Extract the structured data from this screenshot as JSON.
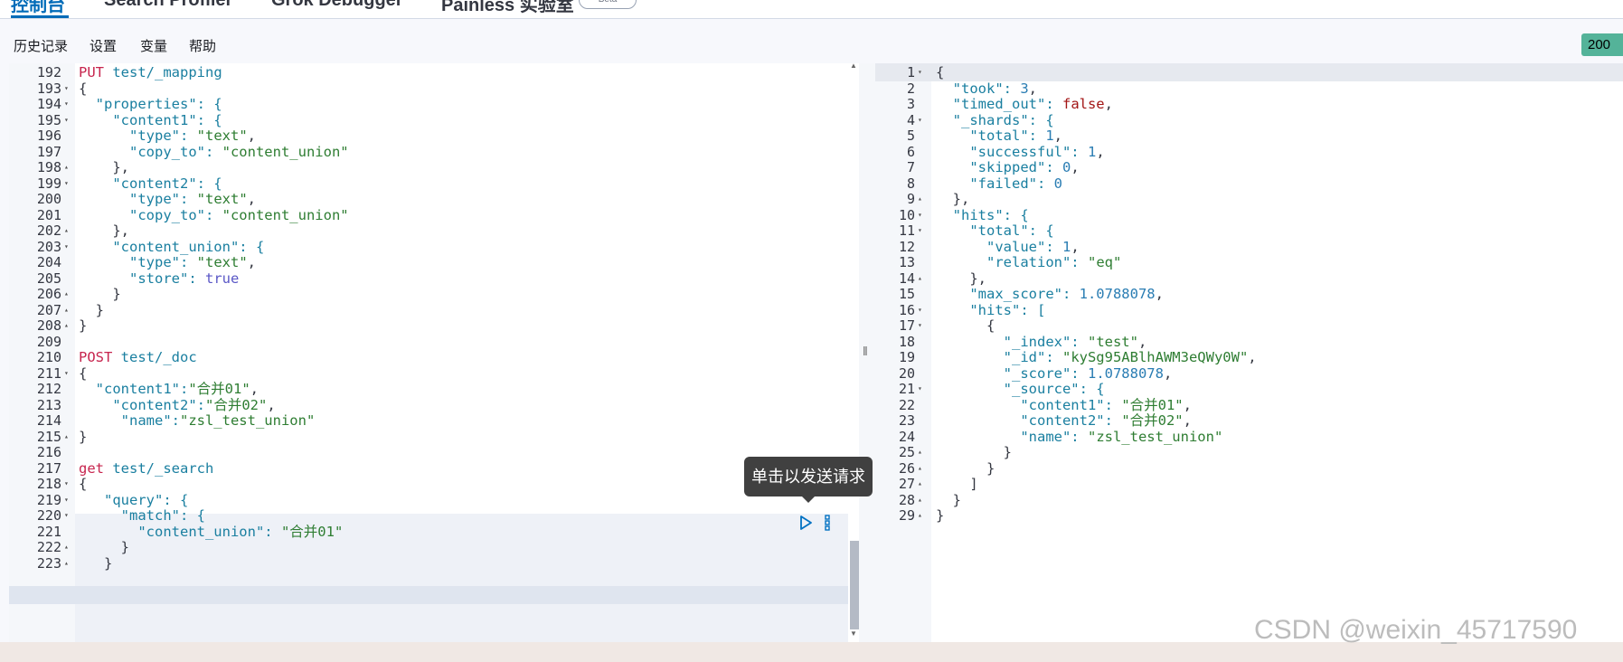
{
  "tabs": [
    "控制台",
    "Search Profiler",
    "Grok Debugger",
    "Painless 实验室"
  ],
  "beta_badge": "Beta",
  "menu": [
    "历史记录",
    "设置",
    "变量",
    "帮助"
  ],
  "status_code": "200",
  "tooltip": "单击以发送请求",
  "watermark": "CSDN @weixin_45717590",
  "request_lines": [
    {
      "n": "192",
      "f": "",
      "t": [
        [
          "PUT",
          "m"
        ],
        [
          " test/_mapping",
          "k"
        ]
      ]
    },
    {
      "n": "193",
      "f": "▾",
      "t": [
        [
          "{",
          ""
        ]
      ]
    },
    {
      "n": "194",
      "f": "▾",
      "t": [
        [
          "  \"properties\": {",
          "k"
        ]
      ]
    },
    {
      "n": "195",
      "f": "▾",
      "t": [
        [
          "    \"content1\": {",
          "k"
        ]
      ]
    },
    {
      "n": "196",
      "f": "",
      "t": [
        [
          "      \"type\": ",
          "k"
        ],
        [
          "\"text\"",
          "s"
        ],
        [
          ",",
          ""
        ]
      ]
    },
    {
      "n": "197",
      "f": "",
      "t": [
        [
          "      \"copy_to\": ",
          "k"
        ],
        [
          "\"content_union\"",
          "s"
        ]
      ]
    },
    {
      "n": "198",
      "f": "▴",
      "t": [
        [
          "    },",
          ""
        ]
      ]
    },
    {
      "n": "199",
      "f": "▾",
      "t": [
        [
          "    \"content2\": {",
          "k"
        ]
      ]
    },
    {
      "n": "200",
      "f": "",
      "t": [
        [
          "      \"type\": ",
          "k"
        ],
        [
          "\"text\"",
          "s"
        ],
        [
          ",",
          ""
        ]
      ]
    },
    {
      "n": "201",
      "f": "",
      "t": [
        [
          "      \"copy_to\": ",
          "k"
        ],
        [
          "\"content_union\"",
          "s"
        ]
      ]
    },
    {
      "n": "202",
      "f": "▴",
      "t": [
        [
          "    },",
          ""
        ]
      ]
    },
    {
      "n": "203",
      "f": "▾",
      "t": [
        [
          "    \"content_union\": {",
          "k"
        ]
      ]
    },
    {
      "n": "204",
      "f": "",
      "t": [
        [
          "      \"type\": ",
          "k"
        ],
        [
          "\"text\"",
          "s"
        ],
        [
          ",",
          ""
        ]
      ]
    },
    {
      "n": "205",
      "f": "",
      "t": [
        [
          "      \"store\": ",
          "k"
        ],
        [
          "true",
          "t"
        ]
      ]
    },
    {
      "n": "206",
      "f": "▴",
      "t": [
        [
          "    }",
          ""
        ]
      ]
    },
    {
      "n": "207",
      "f": "▴",
      "t": [
        [
          "  }",
          ""
        ]
      ]
    },
    {
      "n": "208",
      "f": "▴",
      "t": [
        [
          "}",
          ""
        ]
      ]
    },
    {
      "n": "209",
      "f": "",
      "t": [
        [
          "",
          ""
        ]
      ]
    },
    {
      "n": "210",
      "f": "",
      "t": [
        [
          "POST",
          "m"
        ],
        [
          " test/_doc",
          "k"
        ]
      ]
    },
    {
      "n": "211",
      "f": "▾",
      "t": [
        [
          "{",
          ""
        ]
      ]
    },
    {
      "n": "212",
      "f": "",
      "t": [
        [
          "  \"content1\":",
          "k"
        ],
        [
          "\"合并01\"",
          "s"
        ],
        [
          ",",
          ""
        ]
      ]
    },
    {
      "n": "213",
      "f": "",
      "t": [
        [
          "    \"content2\":",
          "k"
        ],
        [
          "\"合并02\"",
          "s"
        ],
        [
          ",",
          ""
        ]
      ]
    },
    {
      "n": "214",
      "f": "",
      "t": [
        [
          "     \"name\":",
          "k"
        ],
        [
          "\"zsl_test_union\"",
          "s"
        ]
      ]
    },
    {
      "n": "215",
      "f": "▴",
      "t": [
        [
          "}",
          ""
        ]
      ]
    },
    {
      "n": "216",
      "f": "",
      "t": [
        [
          "",
          ""
        ]
      ]
    },
    {
      "n": "217",
      "f": "",
      "t": [
        [
          "get",
          "m"
        ],
        [
          " test/_search",
          "k"
        ]
      ]
    },
    {
      "n": "218",
      "f": "▾",
      "t": [
        [
          "{",
          ""
        ]
      ]
    },
    {
      "n": "219",
      "f": "▾",
      "t": [
        [
          "   \"query\": {",
          "k"
        ]
      ]
    },
    {
      "n": "220",
      "f": "▾",
      "t": [
        [
          "     \"match\": {",
          "k"
        ]
      ]
    },
    {
      "n": "221",
      "f": "",
      "t": [
        [
          "       \"content_union\": ",
          "k"
        ],
        [
          "\"合并01\"",
          "s"
        ]
      ]
    },
    {
      "n": "222",
      "f": "▴",
      "t": [
        [
          "     }",
          ""
        ]
      ]
    },
    {
      "n": "223",
      "f": "▴",
      "t": [
        [
          "   }",
          ""
        ]
      ]
    }
  ],
  "response_lines": [
    {
      "n": "1",
      "f": "▾",
      "t": [
        [
          "{",
          ""
        ]
      ]
    },
    {
      "n": "2",
      "f": "",
      "t": [
        [
          "  \"took\": ",
          "k"
        ],
        [
          "3",
          "n"
        ],
        [
          ",",
          ""
        ]
      ]
    },
    {
      "n": "3",
      "f": "",
      "t": [
        [
          "  \"timed_out\": ",
          "k"
        ],
        [
          "false",
          "b"
        ],
        [
          ",",
          ""
        ]
      ]
    },
    {
      "n": "4",
      "f": "▾",
      "t": [
        [
          "  \"_shards\": {",
          "k"
        ]
      ]
    },
    {
      "n": "5",
      "f": "",
      "t": [
        [
          "    \"total\": ",
          "k"
        ],
        [
          "1",
          "n"
        ],
        [
          ",",
          ""
        ]
      ]
    },
    {
      "n": "6",
      "f": "",
      "t": [
        [
          "    \"successful\": ",
          "k"
        ],
        [
          "1",
          "n"
        ],
        [
          ",",
          ""
        ]
      ]
    },
    {
      "n": "7",
      "f": "",
      "t": [
        [
          "    \"skipped\": ",
          "k"
        ],
        [
          "0",
          "n"
        ],
        [
          ",",
          ""
        ]
      ]
    },
    {
      "n": "8",
      "f": "",
      "t": [
        [
          "    \"failed\": ",
          "k"
        ],
        [
          "0",
          "n"
        ]
      ]
    },
    {
      "n": "9",
      "f": "▴",
      "t": [
        [
          "  },",
          ""
        ]
      ]
    },
    {
      "n": "10",
      "f": "▾",
      "t": [
        [
          "  \"hits\": {",
          "k"
        ]
      ]
    },
    {
      "n": "11",
      "f": "▾",
      "t": [
        [
          "    \"total\": {",
          "k"
        ]
      ]
    },
    {
      "n": "12",
      "f": "",
      "t": [
        [
          "      \"value\": ",
          "k"
        ],
        [
          "1",
          "n"
        ],
        [
          ",",
          ""
        ]
      ]
    },
    {
      "n": "13",
      "f": "",
      "t": [
        [
          "      \"relation\": ",
          "k"
        ],
        [
          "\"eq\"",
          "s"
        ]
      ]
    },
    {
      "n": "14",
      "f": "▴",
      "t": [
        [
          "    },",
          ""
        ]
      ]
    },
    {
      "n": "15",
      "f": "",
      "t": [
        [
          "    \"max_score\": ",
          "k"
        ],
        [
          "1.0788078",
          "n"
        ],
        [
          ",",
          ""
        ]
      ]
    },
    {
      "n": "16",
      "f": "▾",
      "t": [
        [
          "    \"hits\": [",
          "k"
        ]
      ]
    },
    {
      "n": "17",
      "f": "▾",
      "t": [
        [
          "      {",
          ""
        ]
      ]
    },
    {
      "n": "18",
      "f": "",
      "t": [
        [
          "        \"_index\": ",
          "k"
        ],
        [
          "\"test\"",
          "s"
        ],
        [
          ",",
          ""
        ]
      ]
    },
    {
      "n": "19",
      "f": "",
      "t": [
        [
          "        \"_id\": ",
          "k"
        ],
        [
          "\"kySg95ABlhAWM3eQWy0W\"",
          "s"
        ],
        [
          ",",
          ""
        ]
      ]
    },
    {
      "n": "20",
      "f": "",
      "t": [
        [
          "        \"_score\": ",
          "k"
        ],
        [
          "1.0788078",
          "n"
        ],
        [
          ",",
          ""
        ]
      ]
    },
    {
      "n": "21",
      "f": "▾",
      "t": [
        [
          "        \"_source\": {",
          "k"
        ]
      ]
    },
    {
      "n": "22",
      "f": "",
      "t": [
        [
          "          \"content1\": ",
          "k"
        ],
        [
          "\"合并01\"",
          "s"
        ],
        [
          ",",
          ""
        ]
      ]
    },
    {
      "n": "23",
      "f": "",
      "t": [
        [
          "          \"content2\": ",
          "k"
        ],
        [
          "\"合并02\"",
          "s"
        ],
        [
          ",",
          ""
        ]
      ]
    },
    {
      "n": "24",
      "f": "",
      "t": [
        [
          "          \"name\": ",
          "k"
        ],
        [
          "\"zsl_test_union\"",
          "s"
        ]
      ]
    },
    {
      "n": "25",
      "f": "▴",
      "t": [
        [
          "        }",
          ""
        ]
      ]
    },
    {
      "n": "26",
      "f": "▴",
      "t": [
        [
          "      }",
          ""
        ]
      ]
    },
    {
      "n": "27",
      "f": "▴",
      "t": [
        [
          "    ]",
          ""
        ]
      ]
    },
    {
      "n": "28",
      "f": "▴",
      "t": [
        [
          "  }",
          ""
        ]
      ]
    },
    {
      "n": "29",
      "f": "▴",
      "t": [
        [
          "}",
          ""
        ]
      ]
    }
  ],
  "icons": {
    "send": "play-icon",
    "options": "kebab-icon",
    "resize": "drag-handle-icon"
  }
}
